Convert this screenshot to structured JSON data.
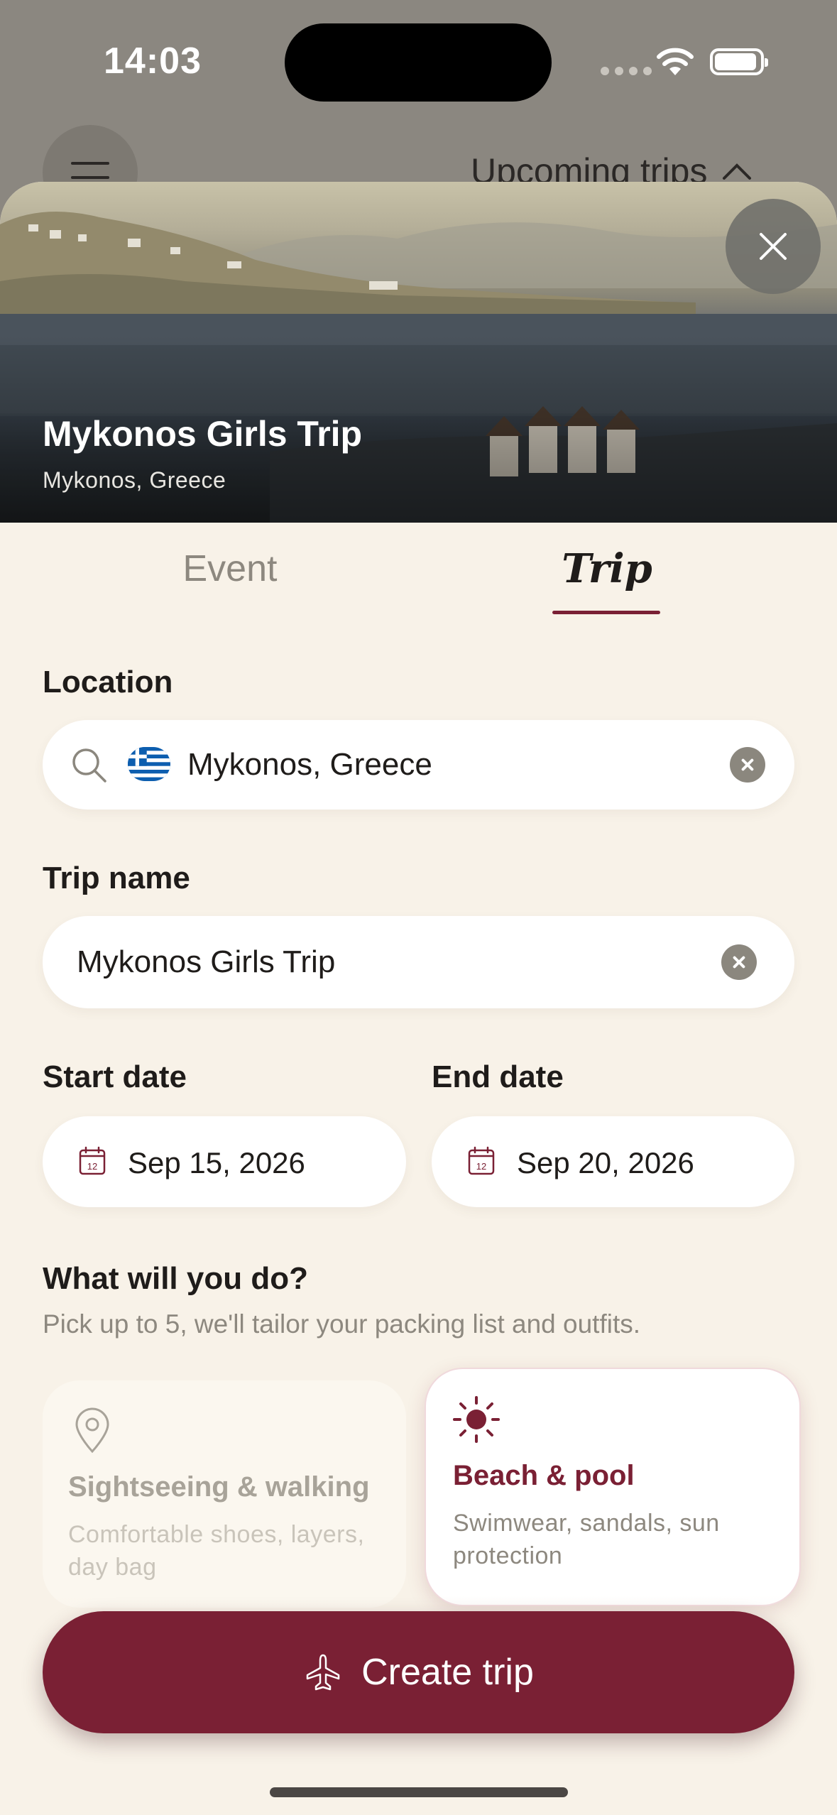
{
  "status_bar": {
    "time": "14:03"
  },
  "background": {
    "title": "Upcoming trips"
  },
  "hero": {
    "title": "Mykonos Girls Trip",
    "subtitle": "Mykonos, Greece"
  },
  "tabs": [
    {
      "label": "Event",
      "selected": false
    },
    {
      "label": "Trip",
      "selected": true
    }
  ],
  "location": {
    "label": "Location",
    "value": "Mykonos, Greece",
    "flag": "greece-flag-icon"
  },
  "trip_name": {
    "label": "Trip name",
    "value": "Mykonos Girls Trip"
  },
  "start_date": {
    "label": "Start date",
    "value": "Sep 15, 2026",
    "icon_day": "12"
  },
  "end_date": {
    "label": "End date",
    "value": "Sep 20, 2026",
    "icon_day": "12"
  },
  "activities": {
    "title": "What will you do?",
    "subtitle": "Pick up to 5, we'll tailor your packing list and outfits.",
    "items": [
      {
        "title": "Sightseeing & walking",
        "description": "Comfortable shoes, layers, day bag",
        "selected": false,
        "icon": "location-pin-icon"
      },
      {
        "title": "Beach & pool",
        "description": "Swimwear, sandals, sun protection",
        "selected": true,
        "icon": "sun-icon"
      }
    ]
  },
  "create_button": {
    "label": "Create trip",
    "icon": "airplane-icon"
  },
  "colors": {
    "accent": "#7a2034",
    "background": "#f8f2e8",
    "muted": "#8d887f"
  }
}
